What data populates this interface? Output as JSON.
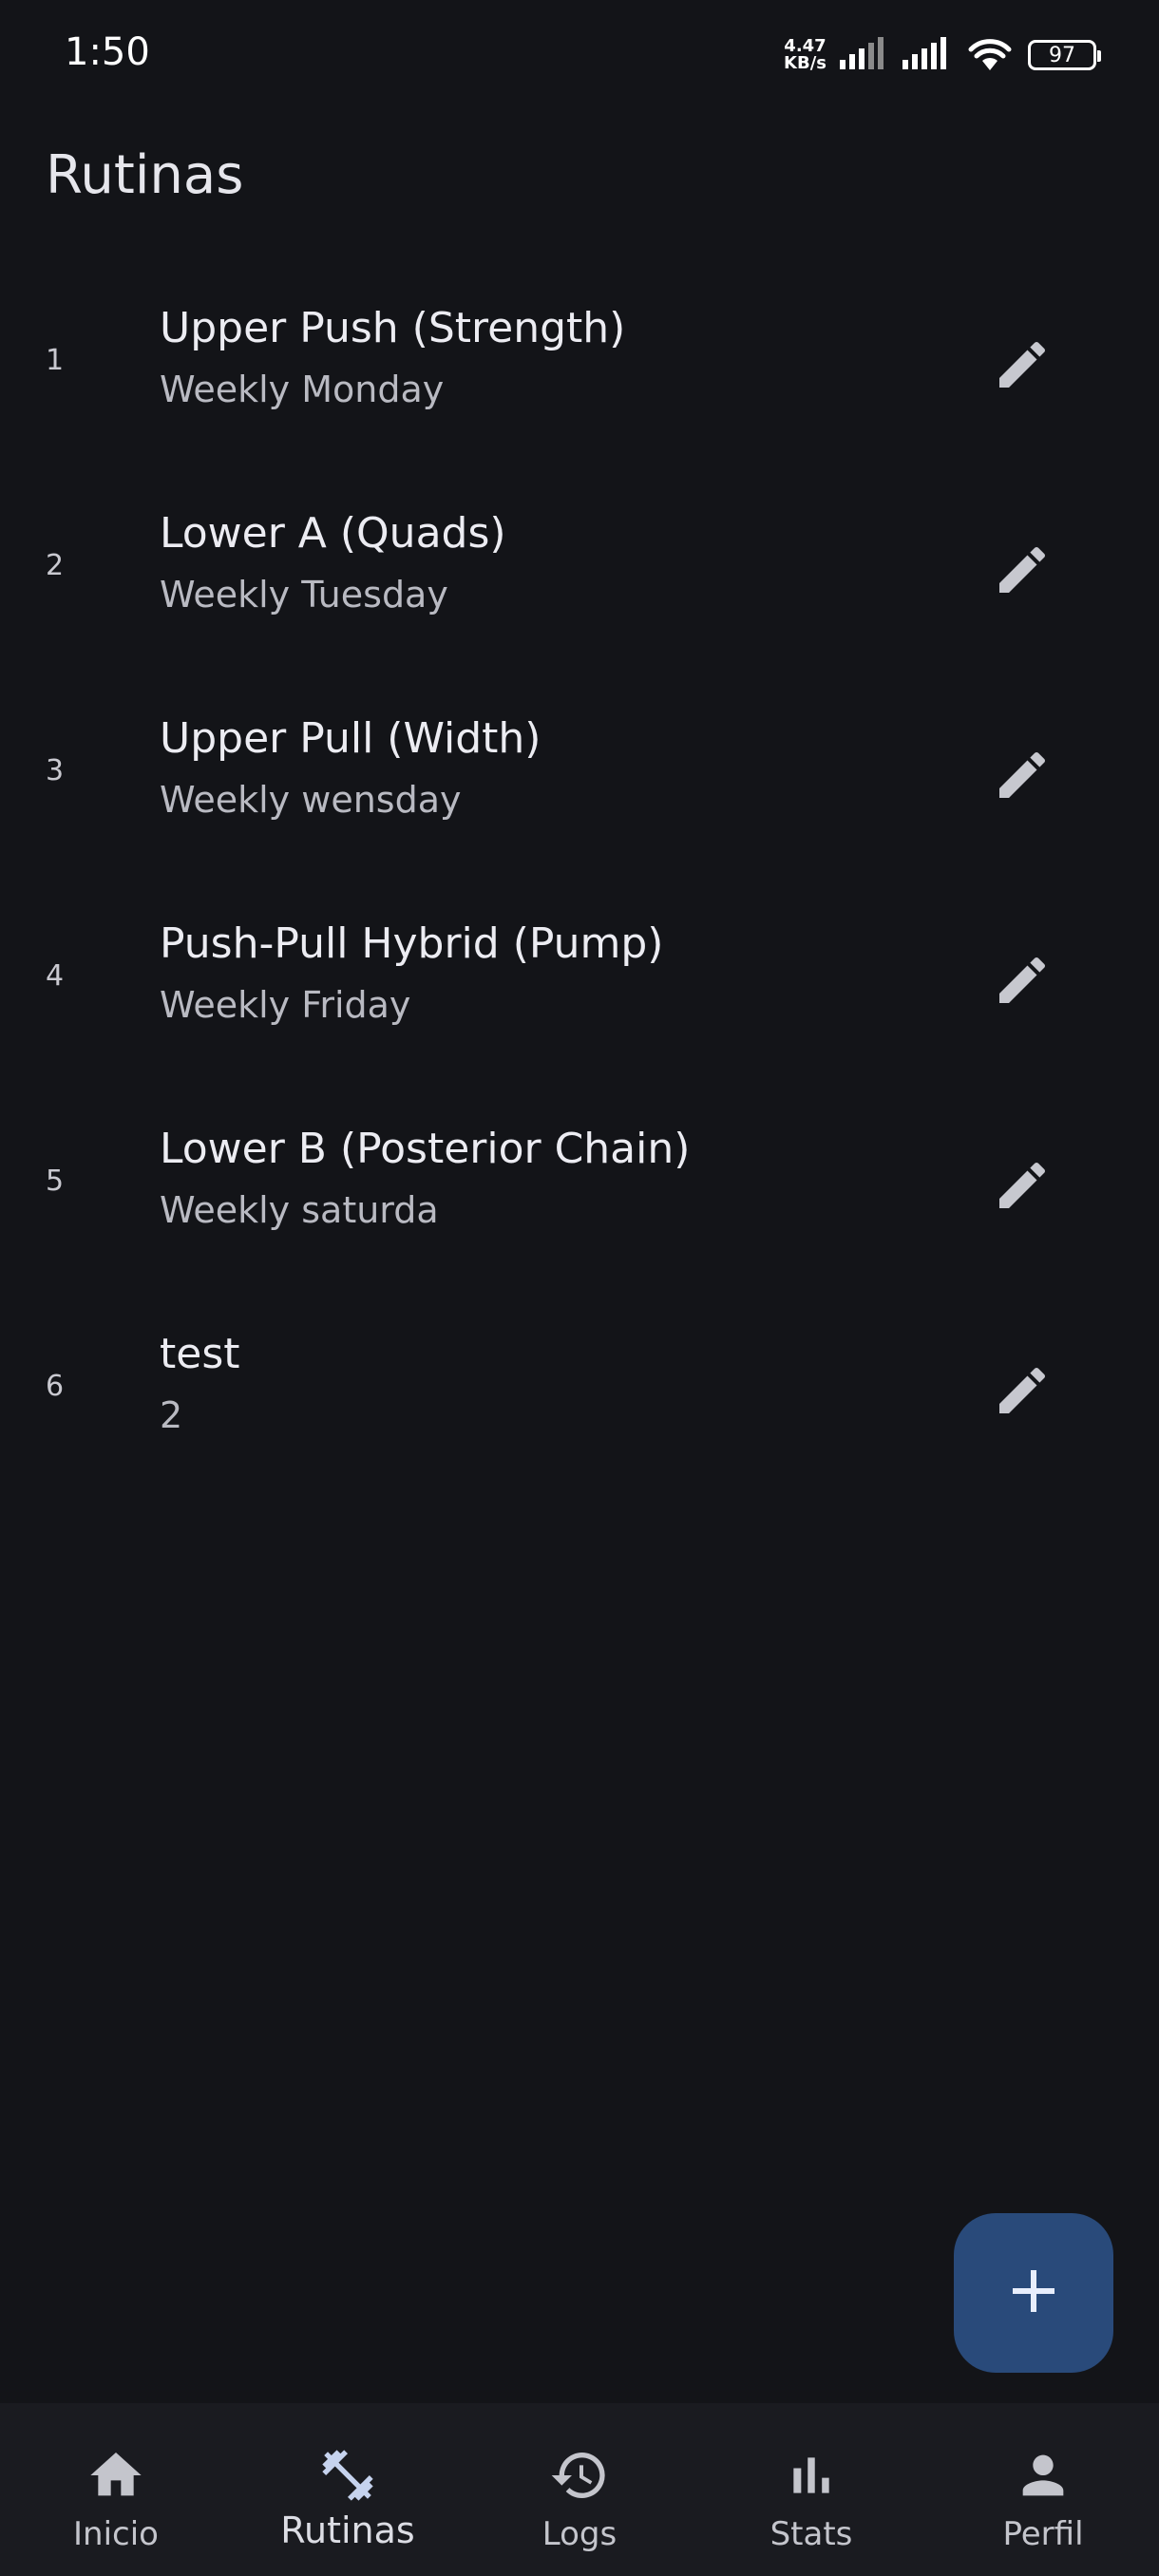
{
  "status_bar": {
    "time": "1:50",
    "net_speed_value": "4.47",
    "net_speed_unit": "KB/s",
    "battery": "97",
    "icons": [
      "signal-icon",
      "signal-icon",
      "wifi-icon",
      "battery-icon"
    ]
  },
  "page": {
    "title": "Rutinas"
  },
  "routines": [
    {
      "index": "1",
      "title": "Upper Push (Strength)",
      "subtitle": "Weekly Monday"
    },
    {
      "index": "2",
      "title": "Lower A (Quads)",
      "subtitle": "Weekly Tuesday"
    },
    {
      "index": "3",
      "title": "Upper Pull (Width)",
      "subtitle": "Weekly wensday"
    },
    {
      "index": "4",
      "title": "Push-Pull Hybrid (Pump)",
      "subtitle": "Weekly Friday"
    },
    {
      "index": "5",
      "title": "Lower B (Posterior Chain)",
      "subtitle": "Weekly saturda"
    },
    {
      "index": "6",
      "title": "test",
      "subtitle": "2"
    }
  ],
  "fab": {
    "icon": "plus-icon"
  },
  "bottom_nav": {
    "items": [
      {
        "label": "Inicio",
        "icon": "home-icon"
      },
      {
        "label": "Rutinas",
        "icon": "dumbbell-icon",
        "active": true
      },
      {
        "label": "Logs",
        "icon": "history-icon"
      },
      {
        "label": "Stats",
        "icon": "bar-chart-icon"
      },
      {
        "label": "Perfil",
        "icon": "person-icon"
      }
    ]
  },
  "colors": {
    "background": "#131418",
    "fab": "#294a7a",
    "nav_background": "#1a1b20",
    "icon": "#c4c5cc"
  }
}
